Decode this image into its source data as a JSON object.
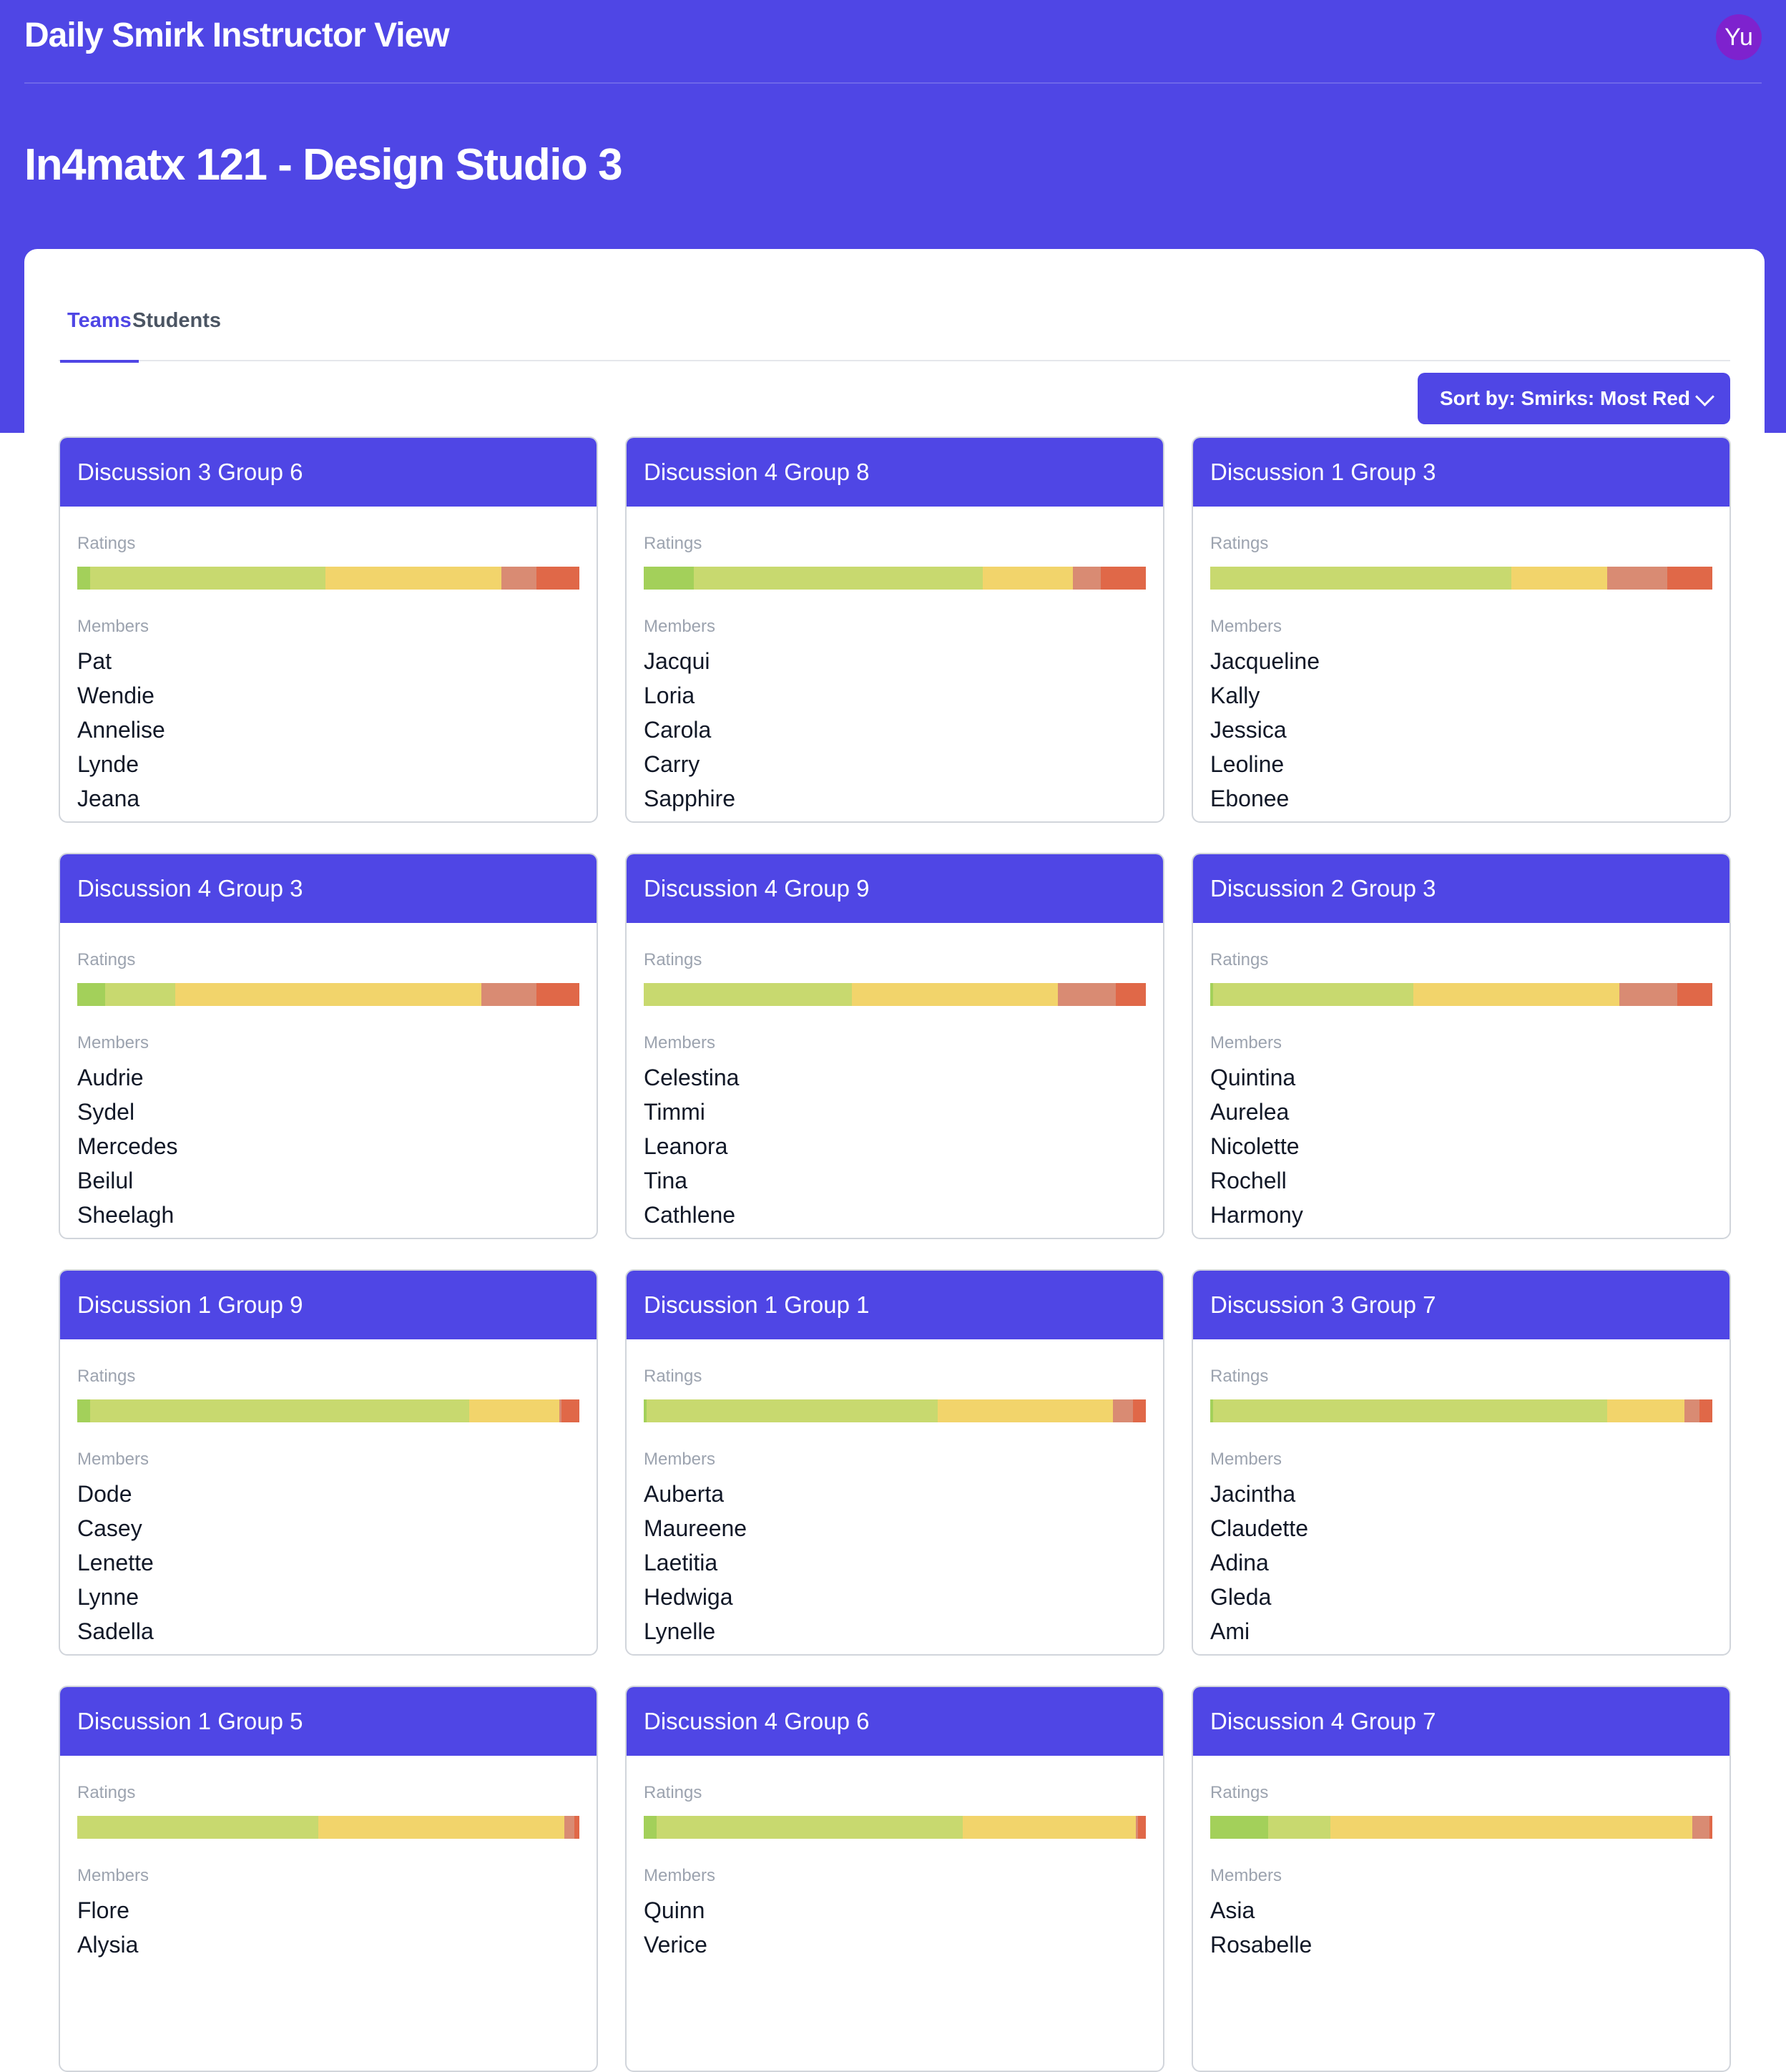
{
  "app": {
    "title": "Daily Smirk Instructor View",
    "avatar_initials": "Yu"
  },
  "course": {
    "title": "In4matx 121 - Design Studio 3"
  },
  "tabs": [
    {
      "label": "Teams",
      "active": true
    },
    {
      "label": "Students",
      "active": false
    }
  ],
  "sort": {
    "label": "Sort by: Smirks: Most Red"
  },
  "section_labels": {
    "ratings": "Ratings",
    "members": "Members"
  },
  "rating_colors": [
    "#a3d05a",
    "#c8d96f",
    "#f2d46b",
    "#d98b73",
    "#e06848"
  ],
  "teams": [
    {
      "name": "Discussion 3 Group 6",
      "ratings": [
        2.5,
        47,
        35,
        7,
        8.5
      ],
      "members": [
        "Pat",
        "Wendie",
        "Annelise",
        "Lynde",
        "Jeana"
      ]
    },
    {
      "name": "Discussion 4 Group 8",
      "ratings": [
        10,
        57.5,
        18,
        5.5,
        9
      ],
      "members": [
        "Jacqui",
        "Loria",
        "Carola",
        "Carry",
        "Sapphire"
      ]
    },
    {
      "name": "Discussion 1 Group 3",
      "ratings": [
        0,
        60,
        19,
        12,
        9
      ],
      "members": [
        "Jacqueline",
        "Kally",
        "Jessica",
        "Leoline",
        "Ebonee"
      ]
    },
    {
      "name": "Discussion 4 Group 3",
      "ratings": [
        5.5,
        14,
        61,
        11,
        8.5
      ],
      "members": [
        "Audrie",
        "Sydel",
        "Mercedes",
        "Beilul",
        "Sheelagh"
      ]
    },
    {
      "name": "Discussion 4 Group 9",
      "ratings": [
        0,
        41.5,
        41,
        11.5,
        6
      ],
      "members": [
        "Celestina",
        "Timmi",
        "Leanora",
        "Tina",
        "Cathlene"
      ]
    },
    {
      "name": "Discussion 2 Group 3",
      "ratings": [
        0.5,
        40,
        41,
        11.5,
        7
      ],
      "members": [
        "Quintina",
        "Aurelea",
        "Nicolette",
        "Rochell",
        "Harmony"
      ]
    },
    {
      "name": "Discussion 1 Group 9",
      "ratings": [
        2.5,
        75.5,
        18,
        0.5,
        3.5
      ],
      "members": [
        "Dode",
        "Casey",
        "Lenette",
        "Lynne",
        "Sadella"
      ]
    },
    {
      "name": "Discussion 1 Group 1",
      "ratings": [
        0.5,
        58,
        35,
        4,
        2.5
      ],
      "members": [
        "Auberta",
        "Maureene",
        "Laetitia",
        "Hedwiga",
        "Lynelle"
      ]
    },
    {
      "name": "Discussion 3 Group 7",
      "ratings": [
        0.5,
        78.5,
        15.5,
        3,
        2.5
      ],
      "members": [
        "Jacintha",
        "Claudette",
        "Adina",
        "Gleda",
        "Ami"
      ]
    },
    {
      "name": "Discussion 1 Group 5",
      "ratings": [
        0,
        48,
        49,
        2,
        1
      ],
      "members": [
        "Flore",
        "Alysia"
      ]
    },
    {
      "name": "Discussion 4 Group 6",
      "ratings": [
        2.5,
        61,
        34.5,
        0.5,
        1.5
      ],
      "members": [
        "Quinn",
        "Verice"
      ]
    },
    {
      "name": "Discussion 4 Group 7",
      "ratings": [
        11.5,
        12.5,
        72,
        3.5,
        0.5
      ],
      "members": [
        "Asia",
        "Rosabelle"
      ]
    }
  ]
}
